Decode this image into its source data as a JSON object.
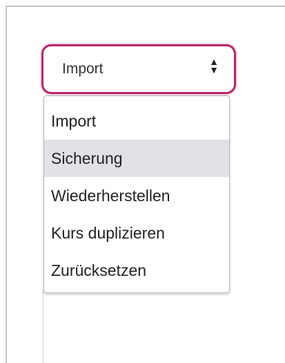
{
  "select": {
    "selected_label": "Import",
    "arrow_icon": "sort-arrows-icon"
  },
  "dropdown": {
    "options": [
      {
        "label": "Import",
        "highlighted": false
      },
      {
        "label": "Sicherung",
        "highlighted": true
      },
      {
        "label": "Wiederherstellen",
        "highlighted": false
      },
      {
        "label": "Kurs duplizieren",
        "highlighted": false
      },
      {
        "label": "Zurücksetzen",
        "highlighted": false
      }
    ]
  },
  "colors": {
    "focus_border": "#b5286a",
    "highlight_bg": "#e1e1e6"
  }
}
